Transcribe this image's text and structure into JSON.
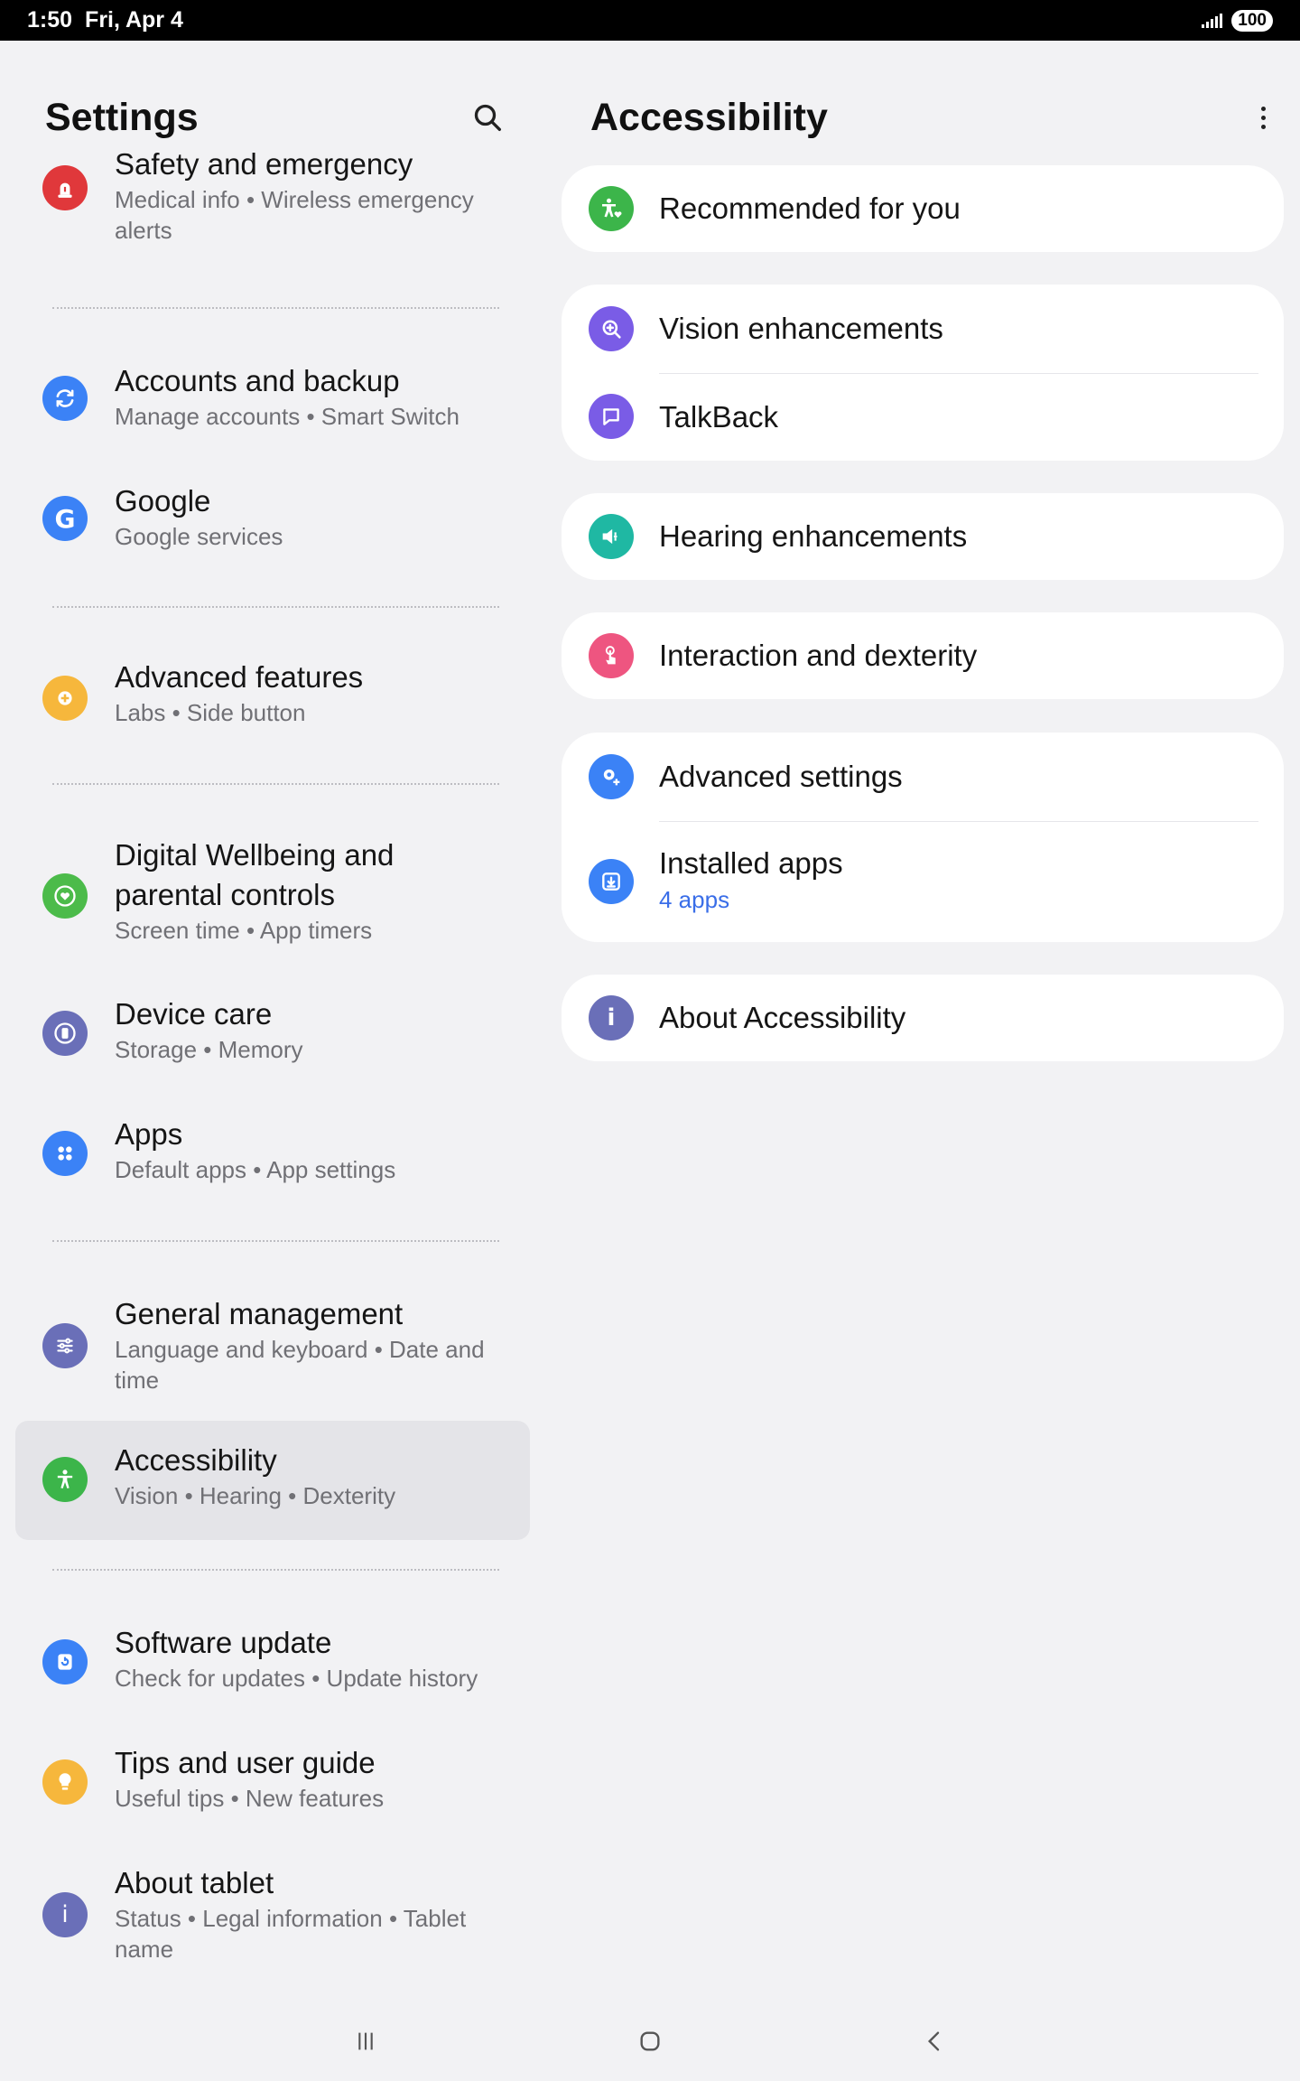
{
  "status_bar": {
    "time": "1:50",
    "date": "Fri, Apr 4",
    "battery": "100"
  },
  "left": {
    "title": "Settings",
    "items": [
      {
        "title": "Safety and emergency",
        "subtitle": "Medical info  •  Wireless emergency alerts",
        "icon": "siren-icon",
        "color": "#e0383b"
      },
      {
        "title": "Accounts and backup",
        "subtitle": "Manage accounts  •  Smart Switch",
        "icon": "sync-icon",
        "color": "#3b82f6"
      },
      {
        "title": "Google",
        "subtitle": "Google services",
        "icon": "google-icon",
        "color": "#3b82f6"
      },
      {
        "title": "Advanced features",
        "subtitle": "Labs  •  Side button",
        "icon": "gear-plus-icon",
        "color": "#f6b73c"
      },
      {
        "title": "Digital Wellbeing and parental controls",
        "subtitle": "Screen time  •  App timers",
        "icon": "heart-circle-icon",
        "color": "#4cbb4a"
      },
      {
        "title": "Device care",
        "subtitle": "Storage  •  Memory",
        "icon": "device-care-icon",
        "color": "#6a6fb8"
      },
      {
        "title": "Apps",
        "subtitle": "Default apps  •  App settings",
        "icon": "apps-grid-icon",
        "color": "#3b82f6"
      },
      {
        "title": "General management",
        "subtitle": "Language and keyboard  •  Date and time",
        "icon": "sliders-icon",
        "color": "#6a6fb8"
      },
      {
        "title": "Accessibility",
        "subtitle": "Vision  •  Hearing  •  Dexterity",
        "icon": "accessibility-icon",
        "color": "#3cb54a"
      },
      {
        "title": "Software update",
        "subtitle": "Check for updates  •  Update history",
        "icon": "update-icon",
        "color": "#3b82f6"
      },
      {
        "title": "Tips and user guide",
        "subtitle": "Useful tips  •  New features",
        "icon": "lightbulb-icon",
        "color": "#f6b73c"
      },
      {
        "title": "About tablet",
        "subtitle": "Status  •  Legal information  •  Tablet name",
        "icon": "info-icon",
        "color": "#6a6fb8"
      }
    ]
  },
  "right": {
    "title": "Accessibility",
    "rows": [
      {
        "label": "Recommended for you",
        "icon": "accessibility-heart-icon",
        "color": "#3cb54a"
      },
      {
        "label": "Vision enhancements",
        "icon": "zoom-in-icon",
        "color": "#7a5ce6"
      },
      {
        "label": "TalkBack",
        "icon": "talkback-icon",
        "color": "#7a5ce6"
      },
      {
        "label": "Hearing enhancements",
        "icon": "speaker-icon",
        "color": "#1fb8a3"
      },
      {
        "label": "Interaction and dexterity",
        "icon": "touch-icon",
        "color": "#ee5580"
      },
      {
        "label": "Advanced settings",
        "icon": "gear-plus-icon",
        "color": "#3b82f6"
      },
      {
        "label": "Installed apps",
        "sublabel": "4 apps",
        "icon": "download-icon",
        "color": "#3b82f6"
      },
      {
        "label": "About Accessibility",
        "icon": "info-icon",
        "color": "#6a6fb8"
      }
    ]
  }
}
